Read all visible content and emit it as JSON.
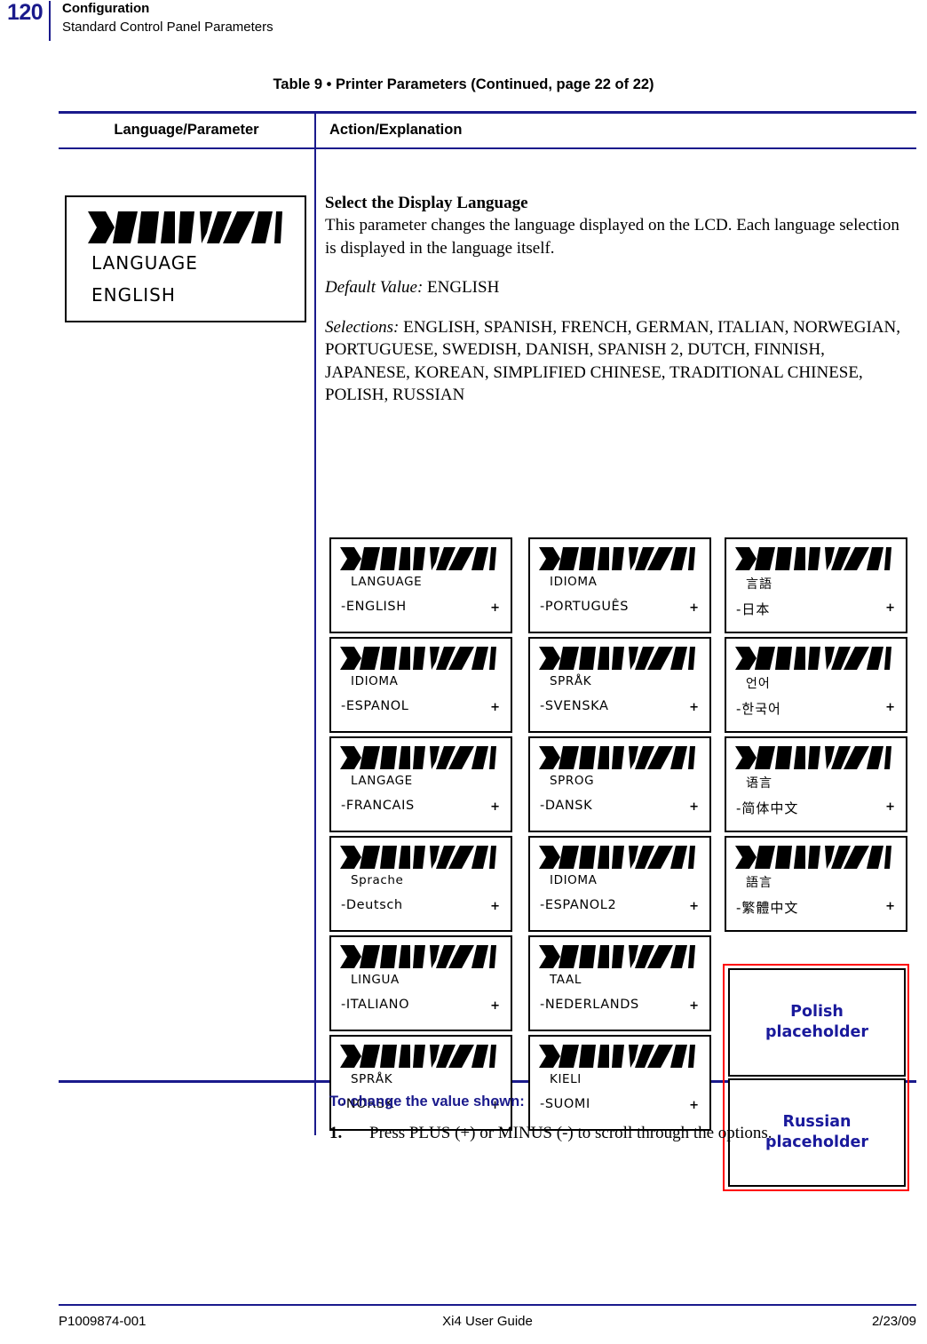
{
  "header": {
    "page_number": "120",
    "title": "Configuration",
    "subtitle": "Standard Control Panel Parameters",
    "accent_color": "#1a1a8c"
  },
  "table": {
    "caption": "Table 9 • Printer Parameters (Continued, page 22 of 22)",
    "columns": [
      "Language/Parameter",
      "Action/Explanation"
    ]
  },
  "parameter": {
    "heading": "Select the Display Language",
    "description": "This parameter changes the language displayed on the LCD. Each language selection is displayed in the language itself.",
    "default_label": "Default Value:",
    "default_value": "ENGLISH",
    "selections_label": "Selections:",
    "selections_value": "ENGLISH, SPANISH, FRENCH, GERMAN, ITALIAN, NORWEGIAN, PORTUGUESE, SWEDISH, DANISH, SPANISH 2, DUTCH, FINNISH, JAPANESE, KOREAN, SIMPLIFIED CHINESE, TRADITIONAL CHINESE, POLISH, RUSSIAN"
  },
  "lcd_sample": {
    "logo": "zebra-logo",
    "label": "LANGUAGE",
    "value": "ENGLISH"
  },
  "lcd_grid": {
    "minus_glyph": "-",
    "plus_glyph": "+",
    "column1": [
      {
        "label": "LANGUAGE",
        "value": "-ENGLISH",
        "plus": "+"
      },
      {
        "label": "IDIOMA",
        "value": "-ESPANOL",
        "plus": "+"
      },
      {
        "label": "LANGAGE",
        "value": "-FRANCAIS",
        "plus": "+"
      },
      {
        "label": "Sprache",
        "value": "-Deutsch",
        "plus": "+"
      },
      {
        "label": "LINGUA",
        "value": "-ITALIANO",
        "plus": "+"
      },
      {
        "label": "SPRÅK",
        "value": "-NORSK",
        "plus": "+"
      }
    ],
    "column2": [
      {
        "label": "IDIOMA",
        "value": "-PORTUGUÊS",
        "plus": "+"
      },
      {
        "label": "SPRÅK",
        "value": "-SVENSKA",
        "plus": "+"
      },
      {
        "label": "SPROG",
        "value": "-DANSK",
        "plus": "+"
      },
      {
        "label": "IDIOMA",
        "value": "-ESPANOL2",
        "plus": "+"
      },
      {
        "label": "TAAL",
        "value": "-NEDERLANDS",
        "plus": "+"
      },
      {
        "label": "KIELI",
        "value": "-SUOMI",
        "plus": "+"
      }
    ],
    "column3": [
      {
        "label": "言語",
        "value": "-日本",
        "plus": "+"
      },
      {
        "label": "언어",
        "value": "-한국어",
        "plus": "+"
      },
      {
        "label": "语言",
        "value": "-简体中文",
        "plus": "+"
      },
      {
        "label": "語言",
        "value": "-繁體中文",
        "plus": "+"
      }
    ]
  },
  "placeholders": {
    "border_color": "#ff0000",
    "text_color": "#1a1a9c",
    "items": [
      {
        "line1": "Polish",
        "line2": "placeholder"
      },
      {
        "line1": "Russian",
        "line2": "placeholder"
      }
    ]
  },
  "procedure": {
    "heading": "To change the value shown:",
    "steps": [
      {
        "number": "1.",
        "text": "Press PLUS (+) or MINUS (-) to scroll through the options."
      }
    ]
  },
  "footer": {
    "left": "P1009874-001",
    "center": "Xi4 User Guide",
    "right": "2/23/09"
  }
}
